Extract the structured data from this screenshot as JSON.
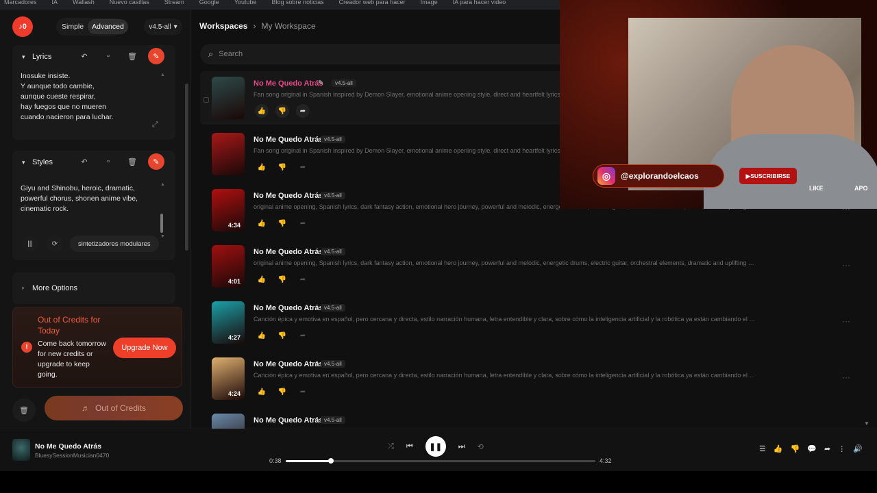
{
  "bookmarks": [
    "Marcadores",
    "IA",
    "Wallash",
    "Nuevo casillas",
    "Stream",
    "Google",
    "Youtube",
    "Blog sobre noticias",
    "Creador web para hacer",
    "Image",
    "IA para hacer video"
  ],
  "sidebar": {
    "logo_text": "♪0",
    "mode": {
      "simple": "Simple",
      "advanced": "Advanced"
    },
    "version": "v4.5-all",
    "lyrics": {
      "title": "Lyrics",
      "text": "Inosuke insiste.\nY aunque todo cambie,\naunque cueste respirar,\nhay fuegos que no mueren\ncuando nacieron para luchar."
    },
    "styles": {
      "title": "Styles",
      "text": "Giyu and Shinobu, heroic, dramatic, powerful chorus, shonen anime vibe, cinematic rock.",
      "tag": "sintetizadores modulares"
    },
    "more_options": "More Options",
    "credits": {
      "title": "Out of Credits for Today",
      "body": "Come back tomorrow for new credits or upgrade to keep going.",
      "upgrade": "Upgrade Now"
    },
    "create_label": "Out of Credits"
  },
  "main": {
    "breadcrumb": {
      "root": "Workspaces",
      "current": "My Workspace"
    },
    "search_placeholder": "Search",
    "songs": [
      {
        "title": "No Me Quedo Atrás",
        "tag": "v4.5-all",
        "duration": "",
        "desc": "Fan song original in Spanish inspired by Demon Slayer, emotional anime opening style, direct and heartfelt lyrics, referer"
      },
      {
        "title": "No Me Quedo Atrás",
        "tag": "v4.5-all",
        "duration": "",
        "desc": "Fan song original in Spanish inspired by Demon Slayer, emotional anime opening style, direct and heartfelt lyrics, referer"
      },
      {
        "title": "No Me Quedo Atrás",
        "tag": "v4.5-all",
        "duration": "4:34",
        "desc": "original anime opening, Spanish lyrics, dark fantasy action, emotional hero journey, powerful and melodic, energetic drums, electric guitar, orchestral elements, dramatic and uplifting chorus, inspir..."
      },
      {
        "title": "No Me Quedo Atrás",
        "tag": "v4.5-all",
        "duration": "4:01",
        "desc": "original anime opening, Spanish lyrics, dark fantasy action, emotional hero journey, powerful and melodic, energetic drums, electric guitar, orchestral elements, dramatic and uplifting chorus, inspir..."
      },
      {
        "title": "No Me Quedo Atrás",
        "tag": "v4.5-all",
        "duration": "4:27",
        "desc": "Canción épica y emotiva en español, pero cercana y directa, estilo narración humana, letra entendible y clara, sobre cómo la inteligencia artificial y la robótica ya están cambiando el mundo y el ser..."
      },
      {
        "title": "No Me Quedo Atrás",
        "tag": "v4.5-all",
        "duration": "4:24",
        "desc": "Canción épica y emotiva en español, pero cercana y directa, estilo narración humana, letra entendible y clara, sobre cómo la inteligencia artificial y la robótica ya están cambiando el mundo y el ser..."
      },
      {
        "title": "No Me Quedo Atrás",
        "tag": "v4.5-all",
        "duration": "",
        "desc": ""
      }
    ],
    "cover_colors": [
      "#2d4a48",
      "#a81818",
      "#b01010",
      "#a01010",
      "#1aa0a8",
      "#e0b070",
      "#6a8aa8"
    ]
  },
  "overlay": {
    "handle": "@explorandoelcaos",
    "subscribe": "▶SUSCRIBIRSE",
    "like": "LIKE",
    "apoya": "APO"
  },
  "player": {
    "title": "No Me Quedo Atrás",
    "artist": "BluesySessionMusician0470",
    "current_time": "0:38",
    "total_time": "4:32",
    "progress": 0.147
  },
  "colors": {
    "accent": "#ee3f2b",
    "pink": "#e54b8a"
  }
}
